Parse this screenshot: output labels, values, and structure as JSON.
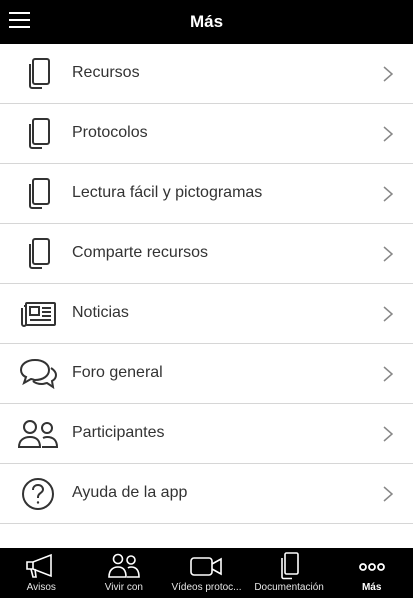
{
  "header": {
    "title": "Más",
    "menu_icon": "hamburger-icon"
  },
  "menu": {
    "items": [
      {
        "label": "Recursos",
        "icon": "document-copy-icon"
      },
      {
        "label": "Protocolos",
        "icon": "document-copy-icon"
      },
      {
        "label": "Lectura fácil y pictogramas",
        "icon": "document-copy-icon"
      },
      {
        "label": "Comparte recursos",
        "icon": "document-copy-icon"
      },
      {
        "label": "Noticias",
        "icon": "newspaper-icon"
      },
      {
        "label": "Foro general",
        "icon": "chat-bubbles-icon"
      },
      {
        "label": "Participantes",
        "icon": "people-icon"
      },
      {
        "label": "Ayuda de la app",
        "icon": "help-icon"
      }
    ]
  },
  "tabbar": {
    "tabs": [
      {
        "label": "Avisos",
        "icon": "megaphone-icon"
      },
      {
        "label": "Vivir con",
        "icon": "people-icon"
      },
      {
        "label": "Vídeos protoc...",
        "icon": "video-camera-icon"
      },
      {
        "label": "Documentación",
        "icon": "document-copy-icon"
      },
      {
        "label": "Más",
        "icon": "more-dots-icon",
        "active": true
      }
    ]
  },
  "colors": {
    "bar": "#000000",
    "text": "#333333",
    "divider": "#d6d6d6",
    "icon": "#333333"
  }
}
